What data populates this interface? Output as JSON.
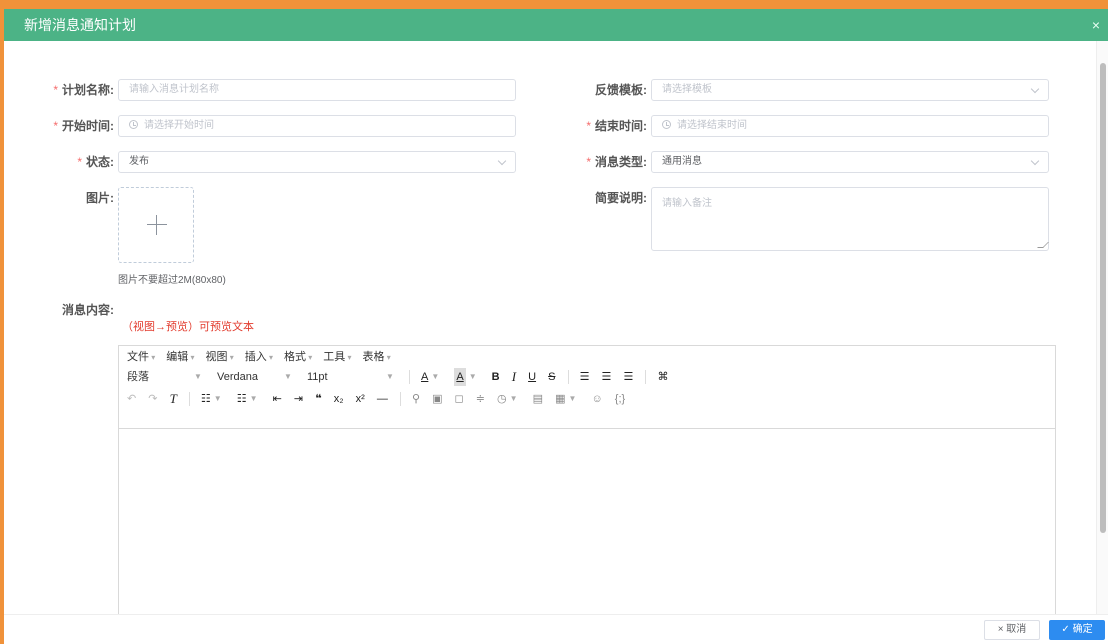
{
  "dialog": {
    "title": "新增消息通知计划",
    "close_icon": "×"
  },
  "form": {
    "plan_name": {
      "label": "计划名称:",
      "placeholder": "请输入消息计划名称"
    },
    "feedback_template": {
      "label": "反馈模板:",
      "placeholder": "请选择模板"
    },
    "start_time": {
      "label": "开始时间:",
      "placeholder": "请选择开始时间"
    },
    "end_time": {
      "label": "结束时间:",
      "placeholder": "请选择结束时间"
    },
    "status": {
      "label": "状态:",
      "value": "发布"
    },
    "message_type": {
      "label": "消息类型:",
      "value": "通用消息"
    },
    "image": {
      "label": "图片:",
      "hint": "图片不要超过2M(80x80)"
    },
    "summary": {
      "label": "简要说明:",
      "placeholder": "请输入备注"
    },
    "content": {
      "label": "消息内容:",
      "preview_hint": "（视图→预览）可预览文本"
    },
    "required_mark": "*"
  },
  "editor": {
    "menus": [
      "文件",
      "编辑",
      "视图",
      "插入",
      "格式",
      "工具",
      "表格"
    ],
    "block_format": "段落",
    "font_family": "Verdana",
    "font_size": "11pt"
  },
  "footer": {
    "cancel_label": "× 取消",
    "ok_label": "✓ 确定"
  },
  "colors": {
    "header": "#4cb386",
    "frame": "#f0923a",
    "primary": "#2d8cf0",
    "required": "#f56c6c",
    "hint_red": "#e23b2d"
  }
}
